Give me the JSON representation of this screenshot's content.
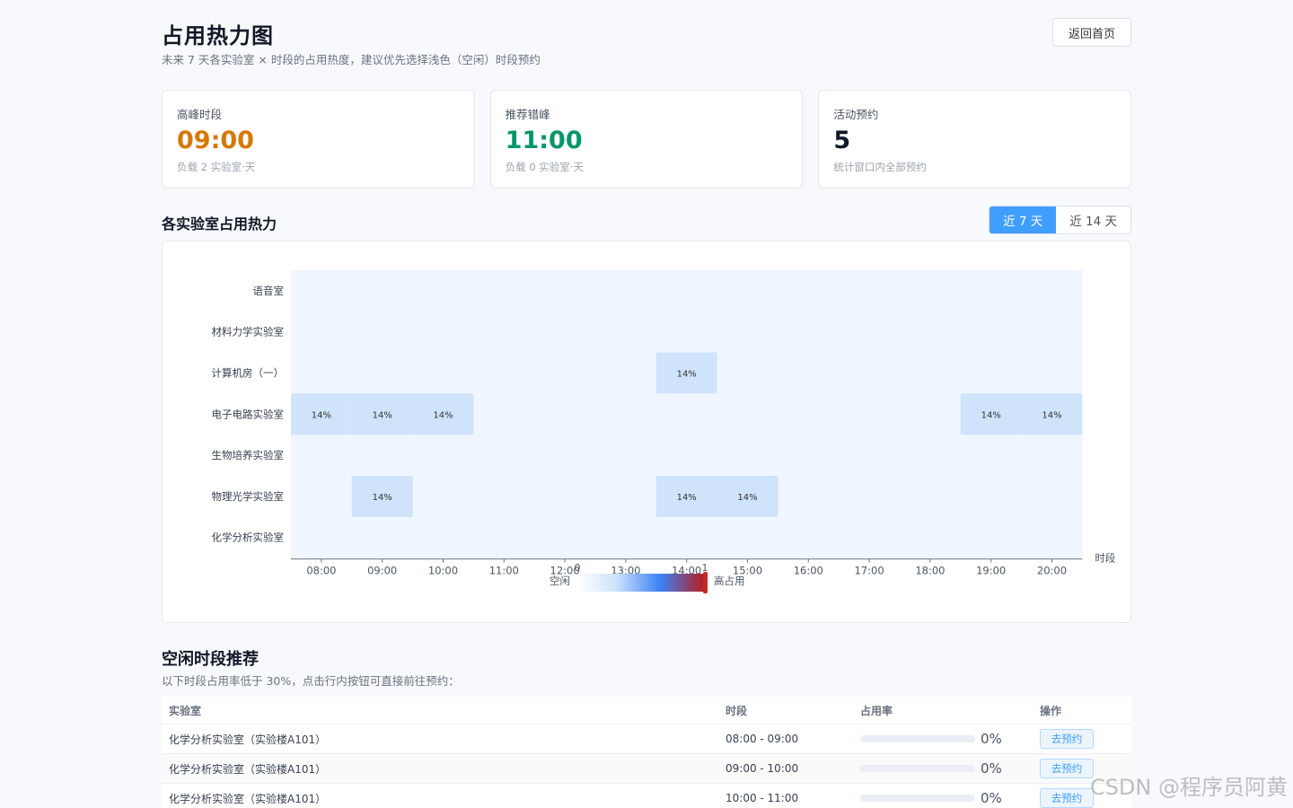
{
  "header": {
    "title": "占用热力图",
    "subtitle": "未来 7 天各实验室 × 时段的占用热度，建议优先选择浅色（空闲）时段预约",
    "back_label": "返回首页"
  },
  "cards": [
    {
      "label": "高峰时段",
      "value": "09:00",
      "note": "负载 2 实验室·天",
      "color": "#d97706"
    },
    {
      "label": "推荐错峰",
      "value": "11:00",
      "note": "负载 0 实验室·天",
      "color": "#059669"
    },
    {
      "label": "活动预约",
      "value": "5",
      "note": "统计窗口内全部预约",
      "color": "#111827"
    }
  ],
  "heat_section": {
    "title": "各实验室占用热力",
    "range_options": [
      "近 7 天",
      "近 14 天"
    ],
    "active_range": 0
  },
  "chart_data": {
    "type": "heatmap",
    "x_label": "时段",
    "x": [
      "08:00",
      "09:00",
      "10:00",
      "11:00",
      "12:00",
      "13:00",
      "14:00",
      "15:00",
      "16:00",
      "17:00",
      "18:00",
      "19:00",
      "20:00"
    ],
    "y": [
      "语音室",
      "材料力学实验室",
      "计算机房（一）",
      "电子电路实验室",
      "生物培养实验室",
      "物理光学实验室",
      "化学分析实验室"
    ],
    "cells": [
      {
        "row": 2,
        "col": 6,
        "value": 0.14,
        "label": "14%"
      },
      {
        "row": 3,
        "col": 0,
        "value": 0.14,
        "label": "14%"
      },
      {
        "row": 3,
        "col": 1,
        "value": 0.14,
        "label": "14%"
      },
      {
        "row": 3,
        "col": 2,
        "value": 0.14,
        "label": "14%"
      },
      {
        "row": 3,
        "col": 11,
        "value": 0.14,
        "label": "14%"
      },
      {
        "row": 3,
        "col": 12,
        "value": 0.14,
        "label": "14%"
      },
      {
        "row": 5,
        "col": 1,
        "value": 0.14,
        "label": "14%"
      },
      {
        "row": 5,
        "col": 6,
        "value": 0.14,
        "label": "14%"
      },
      {
        "row": 5,
        "col": 7,
        "value": 0.14,
        "label": "14%"
      }
    ],
    "visual_map": {
      "min": 0,
      "max": 1,
      "min_label": "0",
      "max_label": "1",
      "low_text": "空闲",
      "high_text": "高占用"
    },
    "colors": {
      "empty": "#eff6ff",
      "low": "#cfe3fb",
      "mid": "#3b82f6",
      "high": "#b91c1c"
    }
  },
  "free_slots": {
    "title": "空闲时段推荐",
    "desc": "以下时段占用率低于 30%，点击行内按钮可直接前往预约：",
    "columns": [
      "实验室",
      "时段",
      "占用率",
      "操作"
    ],
    "rows": [
      {
        "lab": "化学分析实验室（实验楼A101）",
        "slot": "08:00 - 09:00",
        "rate": 0,
        "rate_label": "0%",
        "action": "去预约"
      },
      {
        "lab": "化学分析实验室（实验楼A101）",
        "slot": "09:00 - 10:00",
        "rate": 0,
        "rate_label": "0%",
        "action": "去预约"
      },
      {
        "lab": "化学分析实验室（实验楼A101）",
        "slot": "10:00 - 11:00",
        "rate": 0,
        "rate_label": "0%",
        "action": "去预约"
      }
    ]
  },
  "watermark": "CSDN @程序员阿黄"
}
